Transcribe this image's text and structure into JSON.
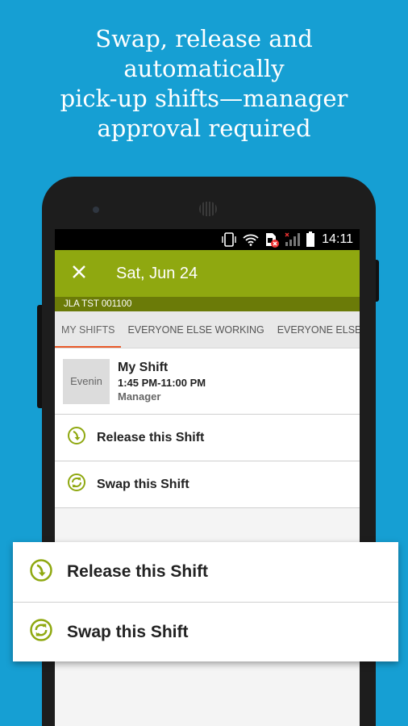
{
  "promo": {
    "line1": "Swap, release and",
    "line2": "automatically",
    "line3": "pick-up shifts—manager",
    "line4": "approval required"
  },
  "status_bar": {
    "time": "14:11",
    "icons": [
      "phone-vibrate-icon",
      "wifi-icon",
      "sim-error-icon",
      "signal-icon",
      "battery-icon"
    ]
  },
  "app_bar": {
    "close_icon": "close-icon",
    "title": "Sat, Jun 24"
  },
  "location": "JLA TST 001100",
  "tabs": [
    {
      "label": "MY SHIFTS",
      "active": true
    },
    {
      "label": "EVERYONE ELSE WORKING",
      "active": false
    },
    {
      "label": "EVERYONE ELSE NOT WORKING",
      "active": false
    }
  ],
  "shift": {
    "thumb_text": "Evenin",
    "title": "My Shift",
    "time": "1:45 PM-11:00 PM",
    "role": "Manager"
  },
  "actions": [
    {
      "label": "Release this Shift",
      "icon": "release-shift-icon"
    },
    {
      "label": "Swap this Shift",
      "icon": "swap-shift-icon"
    }
  ],
  "popup_actions": [
    {
      "label": "Release this Shift",
      "icon": "release-shift-icon"
    },
    {
      "label": "Swap this Shift",
      "icon": "swap-shift-icon"
    }
  ],
  "colors": {
    "background": "#169fd3",
    "app_bar": "#8fa810",
    "sub_bar": "#6b7b08",
    "tab_indicator": "#e95a2a",
    "icon_green": "#8fa810"
  }
}
